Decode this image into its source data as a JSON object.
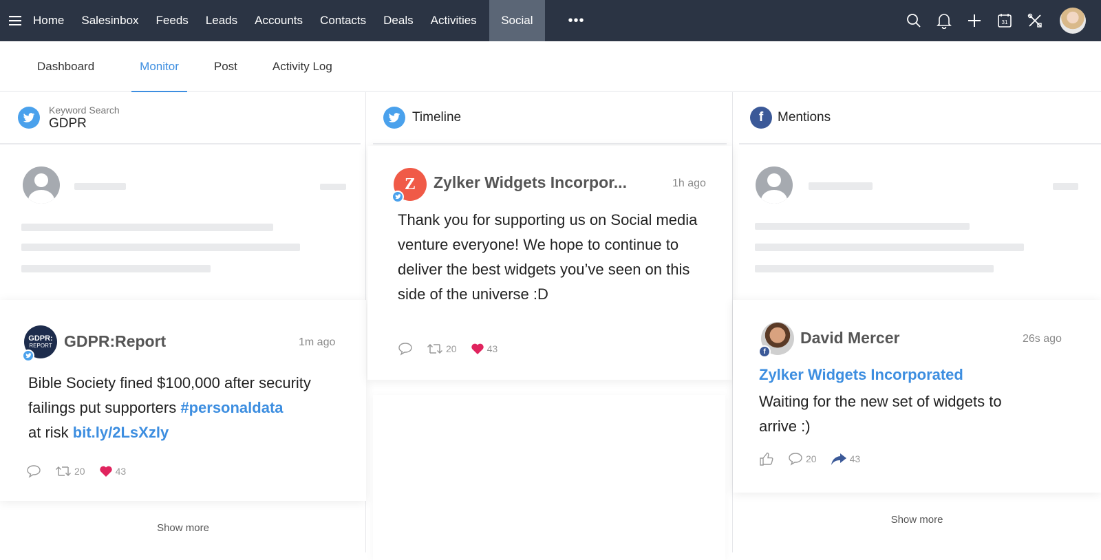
{
  "topnav": {
    "items": [
      "Home",
      "Salesinbox",
      "Feeds",
      "Leads",
      "Accounts",
      "Contacts",
      "Deals",
      "Activities"
    ],
    "active": "Social",
    "more": "•••",
    "calendar_day": "31"
  },
  "subtabs": [
    "Dashboard",
    "Monitor",
    "Post",
    "Activity Log"
  ],
  "columns": {
    "keyword": {
      "label": "Keyword Search",
      "title": "GDPR",
      "post": {
        "author": "GDPR:Report",
        "avatar_text_1": "GDPR:",
        "avatar_text_2": "REPORT",
        "time": "1m ago",
        "text_1": "Bible Society fined $100,000 after security failings put supporters ",
        "hashtag": "#personaldata",
        "text_2": "at risk ",
        "link": "bit.ly/2LsXzly",
        "retweets": "20",
        "likes": "43"
      },
      "show_more": "Show more"
    },
    "timeline": {
      "title": "Timeline",
      "post": {
        "author": "Zylker Widgets Incorpor...",
        "avatar_letter": "Z",
        "time": "1h ago",
        "text": "Thank you for supporting us on Social media venture everyone! We hope to continue to deliver the best widgets you’ve seen on this side of the universe :D",
        "retweets": "20",
        "likes": "43"
      }
    },
    "mentions": {
      "title": "Mentions",
      "post": {
        "author": "David Mercer",
        "time": "26s ago",
        "page_link": "Zylker Widgets Incorporated",
        "text": "Waiting for the new set of widgets to arrive :)",
        "comments": "20",
        "shares": "43"
      },
      "show_more": "Show more"
    }
  },
  "colors": {
    "nav_bg": "#2b3444",
    "active_tab": "#3d8ee0",
    "twitter": "#4aa1ec",
    "facebook": "#3b5998",
    "heart": "#e0245e"
  }
}
